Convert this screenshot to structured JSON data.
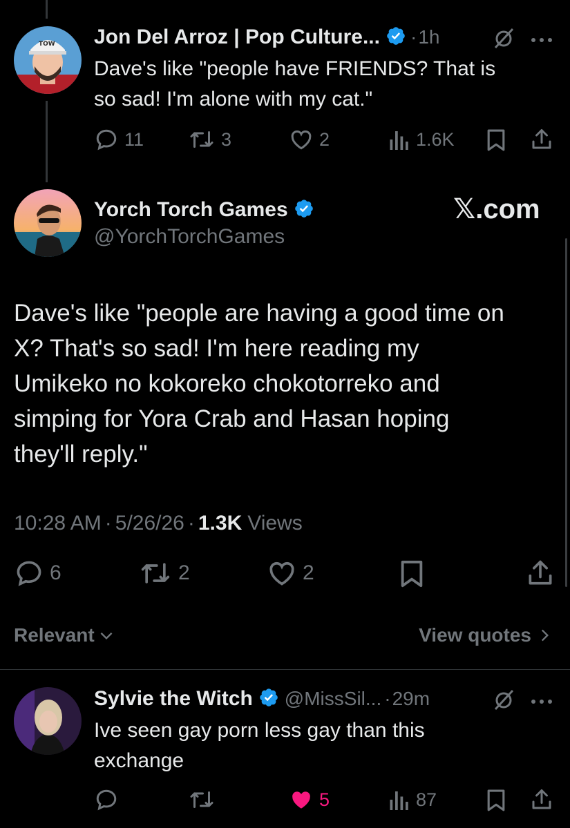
{
  "parent_tweet": {
    "author_name": "Jon Del Arroz | Pop Culture...",
    "time": "1h",
    "dot": "·",
    "text_line1": "Dave's like \"people have FRIENDS? That is",
    "text_line2": "so sad! I'm alone with my cat.\"",
    "replies": "11",
    "reposts": "3",
    "likes": "2",
    "views": "1.6K"
  },
  "main_tweet": {
    "author_name": "Yorch Torch Games",
    "handle": "@YorchTorchGames",
    "watermark": "𝕏.com",
    "lines": [
      "Dave's like \"people are having a good time on",
      "X? That's so sad! I'm here reading my",
      "Umikeko no kokoreko chokotorreko and",
      "simping for Yora Crab and Hasan hoping",
      "they'll reply.\""
    ],
    "time": "10:28 AM",
    "date": "5/26/26",
    "dot": "·",
    "views_count": "1.3K",
    "views_label": "Views",
    "replies": "6",
    "reposts": "2",
    "likes": "2"
  },
  "filters": {
    "sort_label": "Relevant",
    "view_quotes_label": "View quotes"
  },
  "reply_tweet": {
    "author_name": "Sylvie the Witch",
    "handle": "@MissSil...",
    "time": "29m",
    "dot": "·",
    "text_line1": "Ive seen gay porn less gay than this",
    "text_line2": "exchange",
    "likes": "5",
    "views": "87"
  },
  "colors": {
    "background": "#000000",
    "text": "#e7e9ea",
    "secondary": "#71767b",
    "verified_blue": "#1d9bf0",
    "like_pink": "#f91880"
  },
  "icons": [
    "grok-icon",
    "more-icon",
    "reply-icon",
    "repost-icon",
    "like-icon",
    "views-icon",
    "bookmark-icon",
    "share-icon",
    "verified-icon",
    "chevron-down-icon",
    "chevron-right-icon"
  ]
}
